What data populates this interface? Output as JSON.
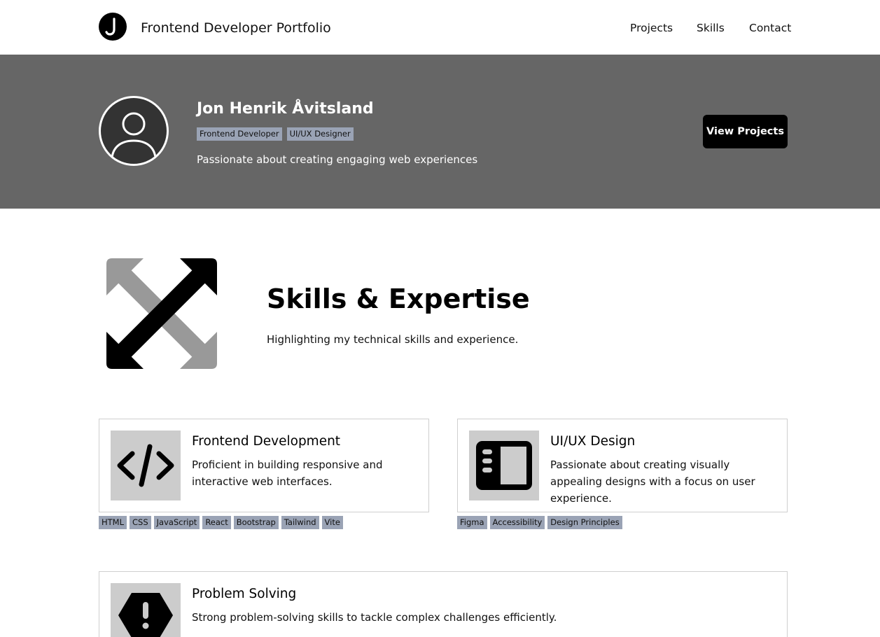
{
  "header": {
    "logo_letter": "J",
    "site_title": "Frontend Developer Portfolio",
    "nav": [
      "Projects",
      "Skills",
      "Contact"
    ]
  },
  "hero": {
    "name": "Jon Henrik Åvitsland",
    "tags": [
      "Frontend Developer",
      "UI/UX Designer"
    ],
    "tagline": "Passionate about creating engaging web experiences",
    "cta_label": "View Projects"
  },
  "skills": {
    "title": "Skills & Expertise",
    "subtitle": "Highlighting my technical skills and experience.",
    "icon": "expand-arrows-icon",
    "cards": [
      {
        "icon": "code-icon",
        "title": "Frontend Development",
        "description": "Proficient in building responsive and interactive web interfaces.",
        "tags": [
          "HTML",
          "CSS",
          "JavaScript",
          "React",
          "Bootstrap",
          "Tailwind",
          "Vite"
        ]
      },
      {
        "icon": "sidebar-layout-icon",
        "title": "UI/UX Design",
        "description": "Passionate about creating visually appealing designs with a focus on user experience.",
        "tags": [
          "Figma",
          "Accessibility",
          "Design Principles"
        ]
      },
      {
        "icon": "alert-octagon-icon",
        "title": "Problem Solving",
        "description": "Strong problem-solving skills to tackle complex challenges efficiently.",
        "tags": []
      }
    ]
  },
  "colors": {
    "hero_bg": "#666666",
    "tag_bg": "#9aa3b5",
    "icon_box_bg": "#cccccc",
    "cta_bg": "#000000"
  }
}
